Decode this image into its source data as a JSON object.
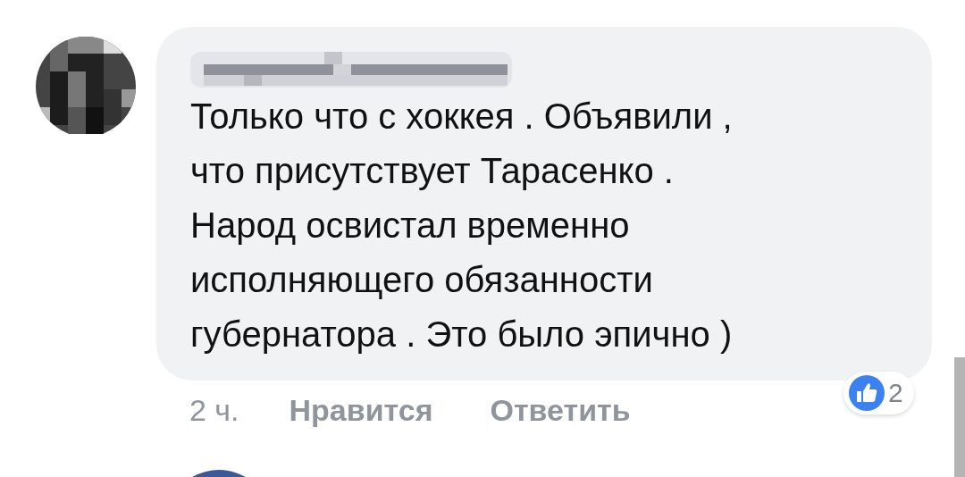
{
  "comment": {
    "text": "Только что с хоккея . Объявили ,\nчто присутствует Тарасенко .\nНарод освистал временно\nисполняющего обязанности\nгубернатора . Это было эпично )",
    "time": "2 ч.",
    "actions": [
      "Нравится",
      "Ответить"
    ],
    "reactions": {
      "count": "2"
    }
  }
}
